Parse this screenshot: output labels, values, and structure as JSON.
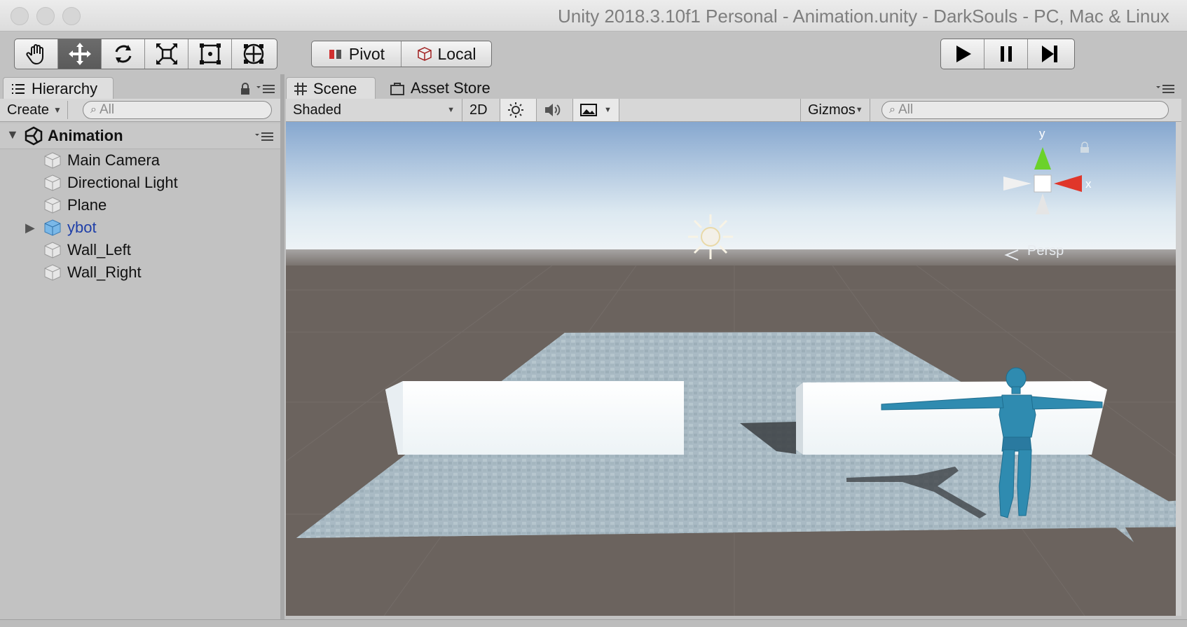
{
  "window": {
    "title": "Unity 2018.3.10f1 Personal - Animation.unity - DarkSouls - PC, Mac & Linux"
  },
  "toolbar": {
    "tools": [
      {
        "name": "hand-tool",
        "icon": "hand-icon",
        "active": false
      },
      {
        "name": "move-tool",
        "icon": "move-arrows-icon",
        "active": true
      },
      {
        "name": "rotate-tool",
        "icon": "rotate-icon",
        "active": false
      },
      {
        "name": "scale-tool",
        "icon": "scale-icon",
        "active": false
      },
      {
        "name": "rect-tool",
        "icon": "rect-transform-icon",
        "active": false
      },
      {
        "name": "transform-tool",
        "icon": "transform-icon",
        "active": false
      }
    ],
    "pivot_label": "Pivot",
    "local_label": "Local",
    "play_icon": "play-icon",
    "pause_icon": "pause-icon",
    "step_icon": "step-icon"
  },
  "hierarchy": {
    "tab_label": "Hierarchy",
    "create_label": "Create",
    "search_placeholder": "All",
    "scene_name": "Animation",
    "items": [
      {
        "label": "Main Camera",
        "selected": false,
        "expandable": false
      },
      {
        "label": "Directional Light",
        "selected": false,
        "expandable": false
      },
      {
        "label": "Plane",
        "selected": false,
        "expandable": false
      },
      {
        "label": "ybot",
        "selected": true,
        "expandable": true
      },
      {
        "label": "Wall_Left",
        "selected": false,
        "expandable": false
      },
      {
        "label": "Wall_Right",
        "selected": false,
        "expandable": false
      }
    ]
  },
  "scene": {
    "tabs": [
      {
        "label": "Scene",
        "active": true,
        "icon": "grid-icon"
      },
      {
        "label": "Asset Store",
        "active": false,
        "icon": "store-bag-icon"
      }
    ],
    "shading_mode": "Shaded",
    "mode_2d": "2D",
    "gizmos_label": "Gizmos",
    "search_placeholder": "All",
    "gizmo_axes": {
      "y": "y",
      "x": "x"
    },
    "projection_label": "Persp"
  },
  "colors": {
    "accent_selected": "#1f3fa8",
    "gizmo_x": "#e0362a",
    "gizmo_y": "#6bd22a",
    "robot": "#2f8bb0",
    "sky_top": "#86a7cf",
    "ground": "#6b635e"
  }
}
